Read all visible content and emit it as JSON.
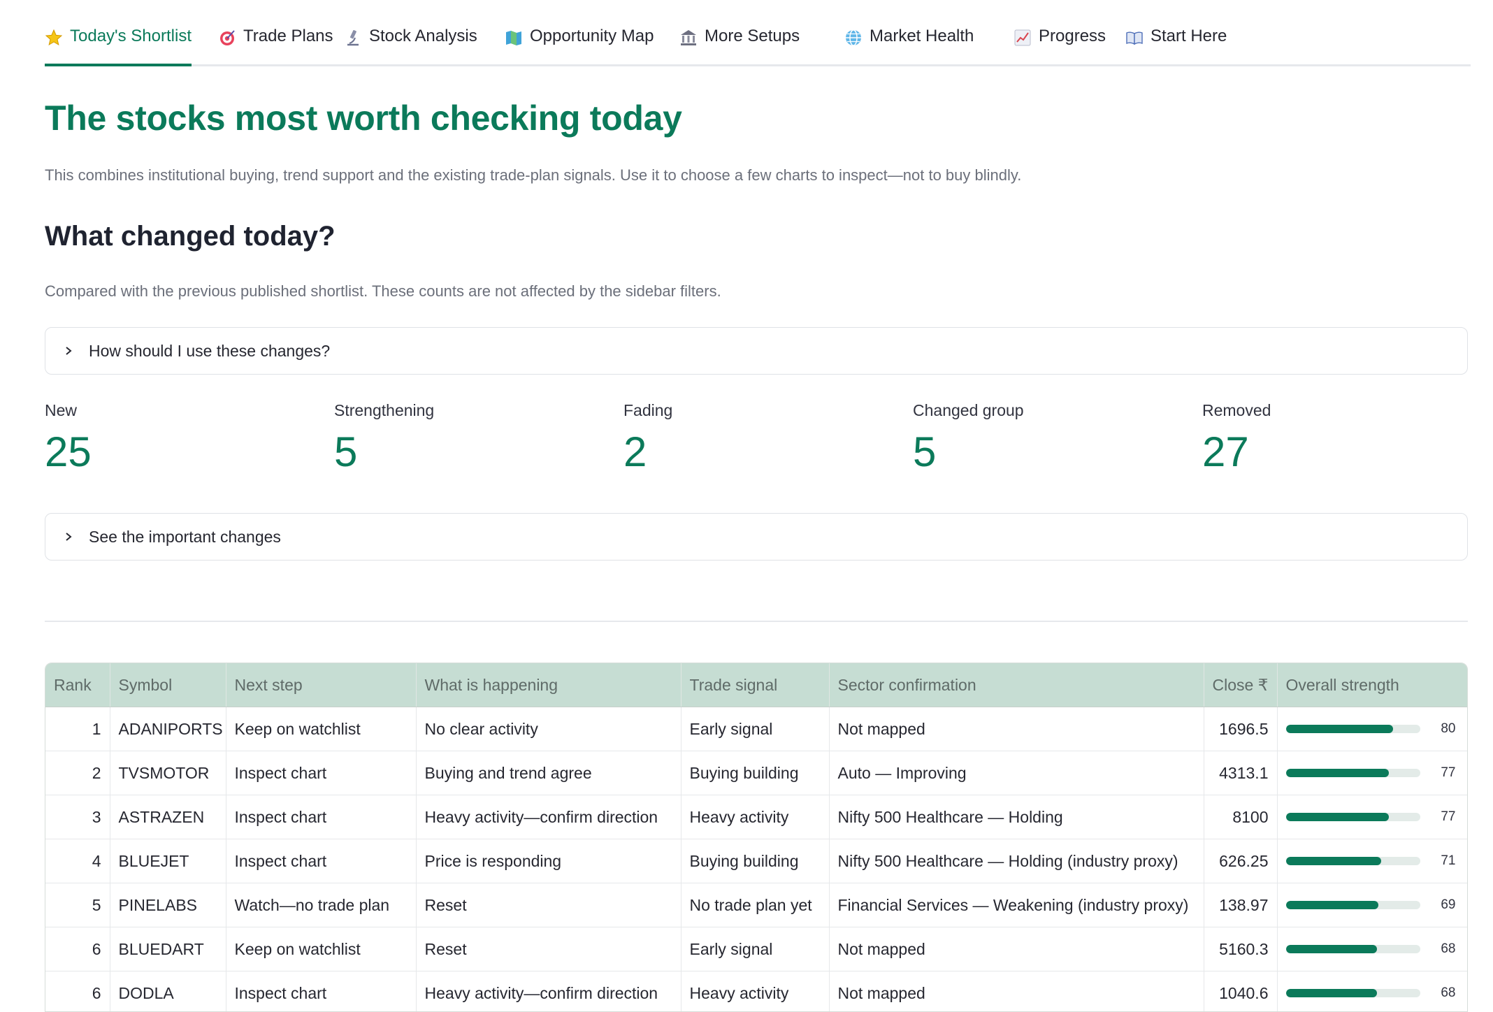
{
  "tabs": [
    {
      "label": "Today's Shortlist",
      "icon": "star-icon",
      "active": true
    },
    {
      "label": "Trade Plans",
      "icon": "target-icon"
    },
    {
      "label": "Stock Analysis",
      "icon": "microscope-icon"
    },
    {
      "label": "Opportunity Map",
      "icon": "map-icon"
    },
    {
      "label": "More Setups",
      "icon": "bank-icon"
    },
    {
      "label": "Market Health",
      "icon": "globe-icon"
    },
    {
      "label": "Progress",
      "icon": "chart-up-icon"
    },
    {
      "label": "Start Here",
      "icon": "book-icon"
    }
  ],
  "page": {
    "title": "The stocks most worth checking today",
    "lead": "This combines institutional buying, trend support and the existing trade-plan signals. Use it to choose a few charts to inspect—not to buy blindly."
  },
  "changes": {
    "heading": "What changed today?",
    "note": "Compared with the previous published shortlist. These counts are not affected by the sidebar filters.",
    "expander_help": "How should I use these changes?",
    "expander_details": "See the important changes",
    "metrics": [
      {
        "label": "New",
        "value": "25"
      },
      {
        "label": "Strengthening",
        "value": "5"
      },
      {
        "label": "Fading",
        "value": "2"
      },
      {
        "label": "Changed group",
        "value": "5"
      },
      {
        "label": "Removed",
        "value": "27"
      }
    ]
  },
  "table": {
    "columns": [
      "Rank",
      "Symbol",
      "Next step",
      "What is happening",
      "Trade signal",
      "Sector confirmation",
      "Close ₹",
      "Overall strength"
    ],
    "strength_max": 100,
    "rows": [
      {
        "rank": "1",
        "symbol": "ADANIPORTS",
        "next": "Keep on watchlist",
        "happening": "No clear activity",
        "signal": "Early signal",
        "sector": "Not mapped",
        "close": "1696.5",
        "strength": 80
      },
      {
        "rank": "2",
        "symbol": "TVSMOTOR",
        "next": "Inspect chart",
        "happening": "Buying and trend agree",
        "signal": "Buying building",
        "sector": "Auto — Improving",
        "close": "4313.1",
        "strength": 77
      },
      {
        "rank": "3",
        "symbol": "ASTRAZEN",
        "next": "Inspect chart",
        "happening": "Heavy activity—confirm direction",
        "signal": "Heavy activity",
        "sector": "Nifty 500 Healthcare — Holding",
        "close": "8100",
        "strength": 77
      },
      {
        "rank": "4",
        "symbol": "BLUEJET",
        "next": "Inspect chart",
        "happening": "Price is responding",
        "signal": "Buying building",
        "sector": "Nifty 500 Healthcare — Holding (industry proxy)",
        "close": "626.25",
        "strength": 71
      },
      {
        "rank": "5",
        "symbol": "PINELABS",
        "next": "Watch—no trade plan",
        "happening": "Reset",
        "signal": "No trade plan yet",
        "sector": "Financial Services — Weakening (industry proxy)",
        "close": "138.97",
        "strength": 69
      },
      {
        "rank": "6",
        "symbol": "BLUEDART",
        "next": "Keep on watchlist",
        "happening": "Reset",
        "signal": "Early signal",
        "sector": "Not mapped",
        "close": "5160.3",
        "strength": 68
      },
      {
        "rank": "6",
        "symbol": "DODLA",
        "next": "Inspect chart",
        "happening": "Heavy activity—confirm direction",
        "signal": "Heavy activity",
        "sector": "Not mapped",
        "close": "1040.6",
        "strength": 68
      }
    ]
  }
}
